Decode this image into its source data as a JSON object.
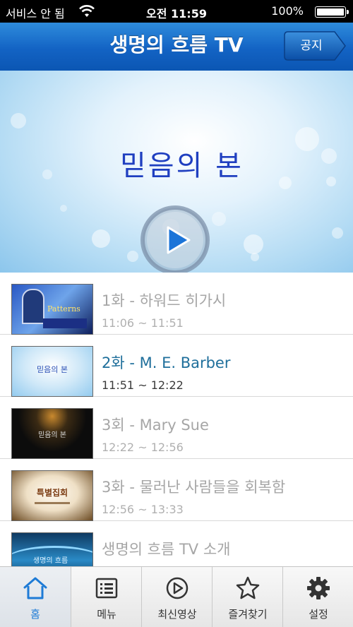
{
  "status_bar": {
    "carrier": "서비스 안 됨",
    "time": "오전 11:59",
    "battery": "100%",
    "icons": [
      "wifi-icon",
      "battery-icon"
    ]
  },
  "nav_bar": {
    "title": "생명의 흐름 TV",
    "notice_button": "공지"
  },
  "hero": {
    "text": "믿음의 본",
    "icon": "play-icon"
  },
  "episodes": [
    {
      "title": "1화 - 하워드 히가시",
      "time": "11:06 ~ 11:51",
      "thumb_text": "Patterns",
      "active": false
    },
    {
      "title": "2화 - M. E. Barber",
      "time": "11:51 ~ 12:22",
      "thumb_text": "믿음의 본",
      "active": true
    },
    {
      "title": "3회 - Mary Sue",
      "time": "12:22 ~ 12:56",
      "thumb_text": "믿음의 본",
      "active": false
    },
    {
      "title": "3화 - 물러난 사람들을 회복함",
      "time": "12:56 ~ 13:33",
      "thumb_text": "특별집회",
      "active": false
    },
    {
      "title": "생명의 흐름 TV 소개",
      "time": "",
      "thumb_text": "생명의 흐름",
      "active": false
    }
  ],
  "tabs": [
    {
      "label": "홈",
      "icon": "home-icon",
      "selected": true
    },
    {
      "label": "메뉴",
      "icon": "list-icon",
      "selected": false
    },
    {
      "label": "최신영상",
      "icon": "play-circle-icon",
      "selected": false
    },
    {
      "label": "즐겨찾기",
      "icon": "star-icon",
      "selected": false
    },
    {
      "label": "설정",
      "icon": "gear-icon",
      "selected": false
    }
  ],
  "colors": {
    "nav_blue": "#1363c4",
    "active_title": "#1f6f9b",
    "tab_selected": "#1e7bd6",
    "inactive_text": "#a6a6a6"
  }
}
